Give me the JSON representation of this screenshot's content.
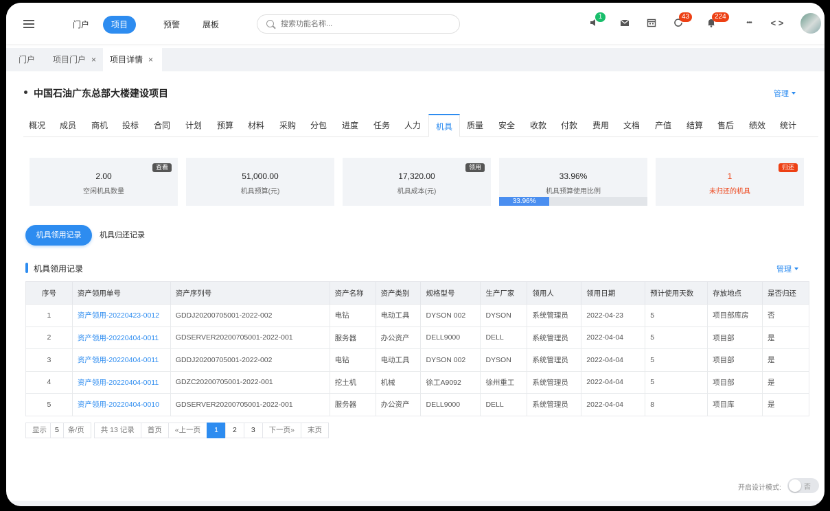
{
  "topnav": {
    "items": [
      "门户",
      "项目",
      "预警",
      "展板"
    ],
    "active": 1
  },
  "search": {
    "placeholder": "搜索功能名称..."
  },
  "toolbar": {
    "speaker_badge": "1",
    "refresh_badge": "43",
    "bell_badge": "224",
    "more_label": "•••",
    "code_label": "< >"
  },
  "page_tabs": [
    {
      "label": "门户",
      "closable": false
    },
    {
      "label": "项目门户",
      "closable": true
    },
    {
      "label": "项目详情",
      "closable": true,
      "active": true
    }
  ],
  "close_glyph": "×",
  "project": {
    "title": "中国石油广东总部大楼建设项目",
    "manage_label": "管理"
  },
  "subnav": [
    "概况",
    "成员",
    "商机",
    "投标",
    "合同",
    "计划",
    "预算",
    "材料",
    "采购",
    "分包",
    "进度",
    "任务",
    "人力",
    "机具",
    "质量",
    "安全",
    "收款",
    "付款",
    "费用",
    "文档",
    "产值",
    "结算",
    "售后",
    "绩效",
    "统计"
  ],
  "subnav_active": "机具",
  "cards": [
    {
      "value": "2.00",
      "label": "空闲机具数量",
      "tag": "查看"
    },
    {
      "value": "51,000.00",
      "label": "机具预算(元)"
    },
    {
      "value": "17,320.00",
      "label": "机具成本(元)",
      "tag": "领用"
    },
    {
      "value": "33.96%",
      "label": "机具预算使用比例",
      "progress_text": "33.96%",
      "progress": 0.3396
    },
    {
      "value": "1",
      "label": "未归还的机具",
      "tag": "归还"
    }
  ],
  "record_tabs": {
    "primary": "机具领用记录",
    "secondary": "机具归还记录"
  },
  "section": {
    "title": "机具领用记录",
    "manage_label": "管理"
  },
  "table": {
    "headers": [
      "序号",
      "资产领用单号",
      "资产序列号",
      "资产名称",
      "资产类别",
      "规格型号",
      "生产厂家",
      "领用人",
      "领用日期",
      "预计使用天数",
      "存放地点",
      "是否归还"
    ],
    "rows": [
      [
        "1",
        "资产领用-20220423-0012",
        "GDDJ20200705001-2022-002",
        "电钻",
        "电动工具",
        "DYSON 002",
        "DYSON",
        "系统管理员",
        "2022-04-23",
        "5",
        "项目部库房",
        "否"
      ],
      [
        "2",
        "资产领用-20220404-0011",
        "GDSERVER20200705001-2022-001",
        "服务器",
        "办公资产",
        "DELL9000",
        "DELL",
        "系统管理员",
        "2022-04-04",
        "5",
        "项目部",
        "是"
      ],
      [
        "3",
        "资产领用-20220404-0011",
        "GDDJ20200705001-2022-002",
        "电钻",
        "电动工具",
        "DYSON 002",
        "DYSON",
        "系统管理员",
        "2022-04-04",
        "5",
        "项目部",
        "是"
      ],
      [
        "4",
        "资产领用-20220404-0011",
        "GDZC20200705001-2022-001",
        "挖土机",
        "机械",
        "徐工A9092",
        "徐州重工",
        "系统管理员",
        "2022-04-04",
        "5",
        "项目部",
        "是"
      ],
      [
        "5",
        "资产领用-20220404-0010",
        "GDSERVER20200705001-2022-001",
        "服务器",
        "办公资产",
        "DELL9000",
        "DELL",
        "系统管理员",
        "2022-04-04",
        "8",
        "项目库",
        "是"
      ]
    ]
  },
  "pager": {
    "show_label": "显示",
    "page_size": "5",
    "per_page_label": "条/页",
    "total_label": "共 13 记录",
    "first": "首页",
    "prev": "«上一页",
    "pages": [
      "1",
      "2",
      "3"
    ],
    "current": "1",
    "next": "下一页»",
    "last": "末页"
  },
  "design_mode": {
    "label": "开启设计模式:",
    "toggle_text": "否"
  }
}
